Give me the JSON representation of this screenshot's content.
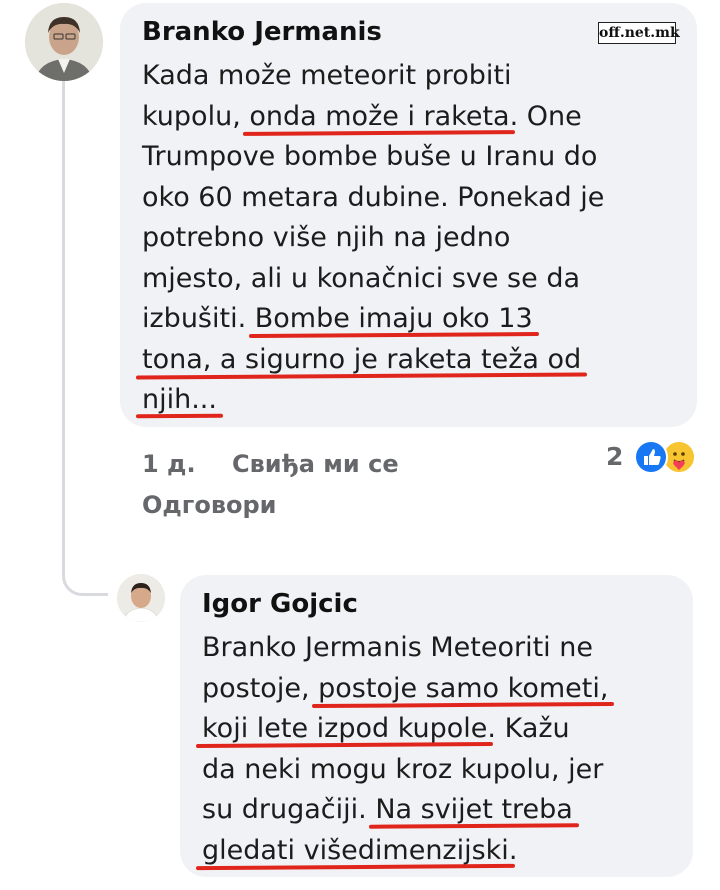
{
  "watermark": "off.net.mk",
  "comment1": {
    "author": "Branko Jermanis",
    "lines": [
      [
        {
          "t": "Kada može meteorit probiti"
        }
      ],
      [
        {
          "t": "kupolu, "
        },
        {
          "t": "onda može i raketa",
          "hl": true
        },
        {
          "t": ". One"
        }
      ],
      [
        {
          "t": "Trumpove bombe buše u Iranu do"
        }
      ],
      [
        {
          "t": "oko 60 metara dubine. Ponekad je"
        }
      ],
      [
        {
          "t": "potrebno više njih na jedno"
        }
      ],
      [
        {
          "t": "mjesto, ali u konačnici sve se da"
        }
      ],
      [
        {
          "t": "izbušiti. "
        },
        {
          "t": "Bombe imaju oko 13",
          "hl": true
        }
      ],
      [
        {
          "t": "tona, a sigurno je raketa teža od",
          "hl": true
        }
      ],
      [
        {
          "t": "njih...",
          "hl": true
        }
      ]
    ],
    "time": "1 д.",
    "like_label": "Свиђа ми се",
    "reply_label": "Одговори",
    "reaction_count": "2",
    "reactions": [
      "like-icon",
      "care-icon"
    ]
  },
  "comment2": {
    "author": "Igor Gojcic",
    "lines": [
      [
        {
          "t": "Branko Jermanis Meteoriti ne"
        }
      ],
      [
        {
          "t": "postoje, "
        },
        {
          "t": "postoje samo kometi,",
          "hl": true
        }
      ],
      [
        {
          "t": "koji lete izpod kupole",
          "hl": true
        },
        {
          "t": ". Kažu"
        }
      ],
      [
        {
          "t": "da neki mogu kroz kupolu, jer"
        }
      ],
      [
        {
          "t": "su drugačiji. "
        },
        {
          "t": "Na svijet treba",
          "hl": true
        }
      ],
      [
        {
          "t": "gledati višedimenzijski",
          "hl": true
        },
        {
          "t": "."
        }
      ]
    ]
  },
  "colors": {
    "underline": "#e0261c",
    "bubble": "#f0f2f5",
    "meta": "#65676b",
    "like": "#1877f2"
  }
}
